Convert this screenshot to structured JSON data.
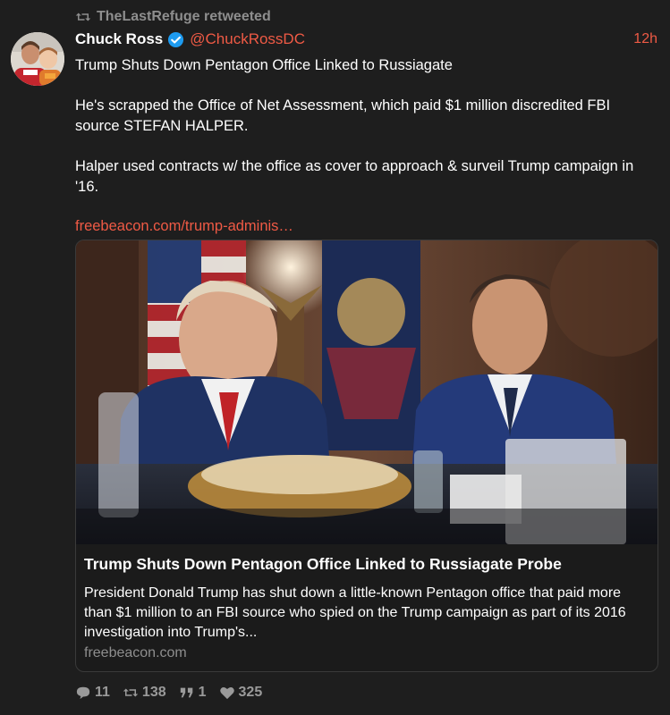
{
  "retweet": {
    "label": "TheLastRefuge retweeted",
    "icon": "retweet-icon"
  },
  "author": {
    "display_name": "Chuck Ross",
    "handle": "@ChuckRossDC",
    "verified_icon": "verified-badge-icon",
    "time": "12h"
  },
  "post": {
    "paragraphs": [
      "Trump Shuts Down Pentagon Office Linked to Russiagate",
      "He's scrapped the Office of Net Assessment, which paid $1 million discredited FBI source STEFAN HALPER.",
      "Halper used contracts w/ the office as cover to approach & surveil Trump campaign in '16."
    ],
    "link": "freebeacon.com/trump-adminis…"
  },
  "card": {
    "title": "Trump Shuts Down Pentagon Office Linked to Russiagate Probe",
    "description": "President Donald Trump has shut down a little-known Pentagon office that paid more than $1 million to an FBI source who spied on the Trump campaign as part of its 2016 investigation into Trump's...",
    "domain": "freebeacon.com"
  },
  "actions": {
    "replies": "11",
    "retweets": "138",
    "quotes": "1",
    "likes": "325"
  },
  "colors": {
    "background": "#1e1e1e",
    "accent": "#ef5a45",
    "muted": "#8e8e8e",
    "verified": "#1d9bf0"
  }
}
